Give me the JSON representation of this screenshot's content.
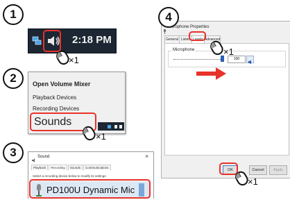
{
  "steps": {
    "s1": "1",
    "s2": "2",
    "s3": "3",
    "s4": "4"
  },
  "step1": {
    "clock": "2:18 PM",
    "click_count": "×1"
  },
  "step2": {
    "menu_items": [
      "Open Volume Mixer",
      "Playback Devices",
      "Recording Devices",
      "Sounds"
    ],
    "click_count": "×1"
  },
  "step3": {
    "window_title": "Sound",
    "close_glyph": "×",
    "tabs": [
      "Playback",
      "Recording",
      "Sounds",
      "Communications"
    ],
    "instruction": "Select a recording device below to modify its settings:",
    "device_name": "PD100U Dynamic Mic"
  },
  "step4": {
    "window_title": "Microphone Properties",
    "tabs": [
      "General",
      "Listen",
      "Levels",
      "Advanced"
    ],
    "section_label": "Microphone",
    "level_value": "100",
    "level_click_count": "×1",
    "buttons": {
      "ok": "OK",
      "cancel": "Cancel",
      "apply": "Apply"
    },
    "ok_click_count": "×1",
    "slider_level_percent": 100
  },
  "colors": {
    "highlight": "#e8322a",
    "arrow": "#e8322a",
    "taskbar": "#1c2733"
  }
}
